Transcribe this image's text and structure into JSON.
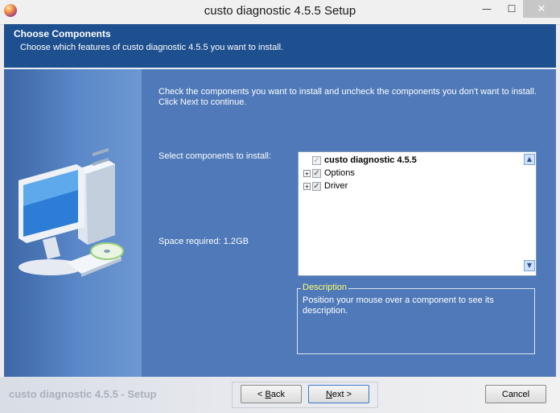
{
  "window": {
    "title": "custo diagnostic 4.5.5 Setup",
    "controls": {
      "minimize": "—",
      "maximize": "☐",
      "close": "✕"
    }
  },
  "header": {
    "title": "Choose Components",
    "subtitle": "Choose which features of custo diagnostic 4.5.5 you want to install."
  },
  "main": {
    "instructions": "Check the components you want to install and uncheck the components you don't want to install. Click Next to continue.",
    "select_label": "Select components to install:",
    "space_required": "Space required: 1.2GB",
    "components": [
      {
        "label": "custo diagnostic 4.5.5",
        "expander": "",
        "checked": true,
        "bold": true,
        "dimmed": true
      },
      {
        "label": "Options",
        "expander": "+",
        "checked": true,
        "bold": false,
        "dimmed": false
      },
      {
        "label": "Driver",
        "expander": "+",
        "checked": true,
        "bold": false,
        "dimmed": false
      }
    ],
    "description": {
      "legend": "Description",
      "text": "Position your mouse over a component to see its description."
    }
  },
  "footer": {
    "brand": "custo diagnostic 4.5.5 - Setup",
    "back_prefix": "< ",
    "back_accel": "B",
    "back_rest": "ack",
    "next_accel": "N",
    "next_rest": "ext >",
    "cancel": "Cancel"
  },
  "icons": {
    "scroll_up": "▲",
    "scroll_down": "▼",
    "check": "✓"
  },
  "colors": {
    "header_bg": "#1e4f8e",
    "body_bg": "#4f79b8",
    "legend_text": "#ffff70"
  }
}
